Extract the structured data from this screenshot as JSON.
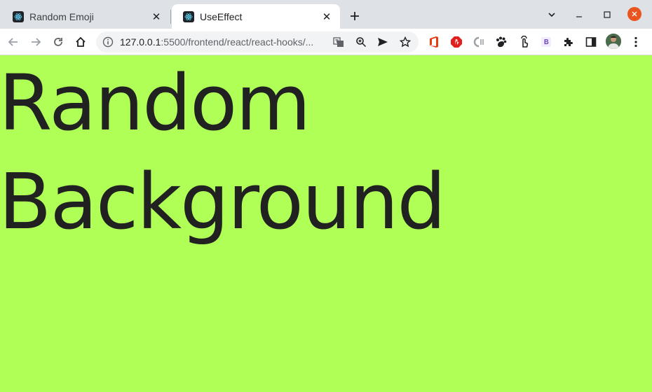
{
  "browser": {
    "tabs": [
      {
        "title": "Random Emoji",
        "active": false,
        "favicon": "react-icon"
      },
      {
        "title": "UseEffect",
        "active": true,
        "favicon": "react-icon"
      }
    ],
    "address": {
      "host": "127.0.0.1",
      "path": ":5500/frontend/react/react-hooks/..."
    },
    "colors": {
      "window_close": "#e95420",
      "tab_strip": "#dee1e6"
    }
  },
  "page": {
    "heading": "Random Background",
    "background_color": "#b0ff57",
    "text_color": "#212121"
  }
}
